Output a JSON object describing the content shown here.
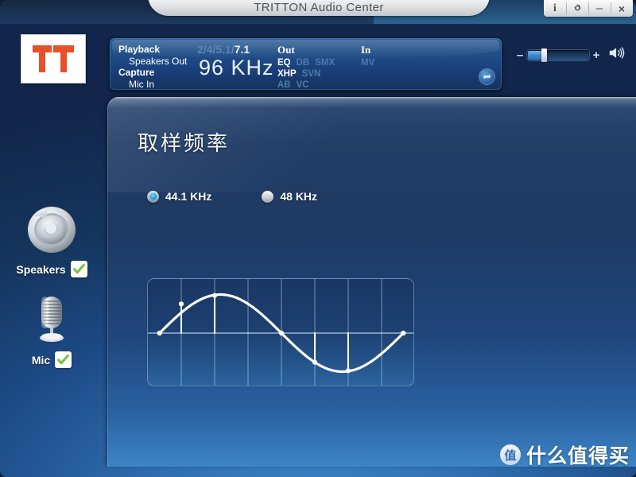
{
  "window": {
    "title": "TRITTON Audio Center",
    "buttons": [
      {
        "name": "info",
        "label": "i"
      },
      {
        "name": "settings",
        "label": "gear-icon"
      },
      {
        "name": "minimize",
        "label": "–"
      },
      {
        "name": "close",
        "label": "×"
      }
    ]
  },
  "logo": {
    "alt": "TRITTON",
    "color": "#e8502a"
  },
  "status": {
    "playback_label": "Playback",
    "playback_device": "Speakers Out",
    "capture_label": "Capture",
    "capture_device": "Mic In",
    "channels_inactive": "2/4/5.1/",
    "channels_active": "7.1",
    "sample_rate": "96  KHz",
    "out_header": "Out",
    "in_header": "In",
    "out_flags": [
      {
        "label": "EQ",
        "active": true
      },
      {
        "label": "DB",
        "active": false
      },
      {
        "label": "SMX",
        "active": false
      },
      {
        "label": "XHP",
        "active": true
      },
      {
        "label": "SVN",
        "active": false
      },
      {
        "label": "AB",
        "active": false
      },
      {
        "label": "VC",
        "active": false
      }
    ],
    "in_flags": [
      {
        "label": "MV",
        "active": false
      }
    ],
    "swap_icon": "swap-icon"
  },
  "volume": {
    "minus": "–",
    "plus": "+",
    "level_percent": 24,
    "speaker_icon": "speaker-icon"
  },
  "devices": [
    {
      "name": "Speakers",
      "label": "Speakers",
      "icon": "speaker-icon",
      "enabled": true
    },
    {
      "name": "Mic",
      "label": "Mic",
      "icon": "microphone-icon",
      "enabled": true
    }
  ],
  "main": {
    "heading": "取样频率",
    "options": [
      {
        "label": "44.1 KHz",
        "selected": true
      },
      {
        "label": "48 KHz",
        "selected": false
      }
    ]
  },
  "chart_data": {
    "type": "line",
    "title": "",
    "xlabel": "",
    "ylabel": "",
    "grid": true,
    "legend": null,
    "xlim": [
      0,
      8
    ],
    "ylim": [
      -1.15,
      1.15
    ],
    "description": "Sine waveform with sampled points and stems to the zero axis",
    "gridlines_x": [
      1,
      2,
      3,
      4,
      5,
      6,
      7
    ],
    "zero_axis_y": 0,
    "series": [
      {
        "name": "waveform",
        "x": [
          0.35,
          1.0,
          2.0,
          3.0,
          4.0,
          5.0,
          6.0,
          7.0,
          7.65
        ],
        "y": [
          0.0,
          0.62,
          0.8,
          0.8,
          0.0,
          -0.62,
          -0.8,
          -0.62,
          0.0
        ]
      }
    ],
    "sample_points": [
      {
        "x": 0.35,
        "y": 0.0
      },
      {
        "x": 1.0,
        "y": 0.62
      },
      {
        "x": 2.0,
        "y": 0.8
      },
      {
        "x": 4.0,
        "y": 0.0
      },
      {
        "x": 5.0,
        "y": -0.62
      },
      {
        "x": 6.0,
        "y": -0.8
      },
      {
        "x": 7.65,
        "y": 0.0
      }
    ]
  },
  "watermark": {
    "badge": "值",
    "text": "什么值得买"
  }
}
